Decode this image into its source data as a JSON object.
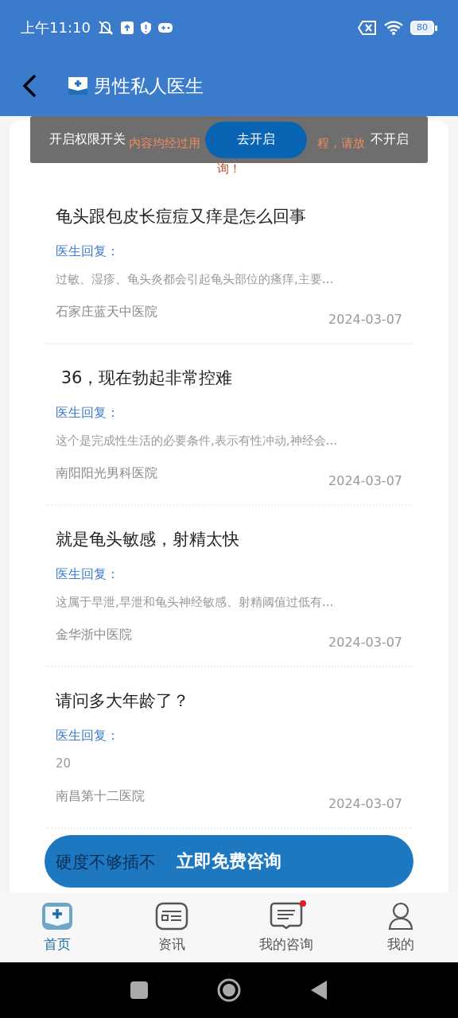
{
  "status_bar": {
    "time": "上午11:10",
    "battery": "80"
  },
  "header": {
    "title": "男性私人医生"
  },
  "notice": {
    "fragments": [
      "内容均经过用",
      "程，请放"
    ],
    "tail": "询！"
  },
  "toast": {
    "label": "开启权限开关",
    "confirm": "去开启",
    "cancel": "不开启"
  },
  "questions": [
    {
      "title": "龟头跟包皮长痘痘又痒是怎么回事",
      "reply_label": "医生回复：",
      "reply": "过敏、湿疹、龟头炎都会引起龟头部位的瘙痒,主要…",
      "hospital": "石家庄蓝天中医院",
      "date": "2024-03-07"
    },
    {
      "title": " 36，现在勃起非常控难",
      "reply_label": "医生回复：",
      "reply": "这个是完成性生活的必要条件,表示有性冲动,神经会…",
      "hospital": "南阳阳光男科医院",
      "date": "2024-03-07"
    },
    {
      "title": "就是龟头敏感，射精太快",
      "reply_label": "医生回复：",
      "reply": "这属于早泄,早泄和龟头神经敏感、射精阈值过低有…",
      "hospital": "金华浙中医院",
      "date": "2024-03-07"
    },
    {
      "title": "请问多大年龄了？",
      "reply_label": "医生回复：",
      "reply": "20",
      "hospital": "南昌第十二医院",
      "date": "2024-03-07"
    },
    {
      "title": "硬度不够插不"
    }
  ],
  "consult_button": "立即免费咨询",
  "tabs": [
    {
      "kind": "home",
      "label": "首页",
      "selected": true,
      "dot": false
    },
    {
      "kind": "news",
      "label": "资讯",
      "selected": false,
      "dot": false
    },
    {
      "kind": "chat",
      "label": "我的咨询",
      "selected": false,
      "dot": true
    },
    {
      "kind": "profile",
      "label": "我的",
      "selected": false,
      "dot": false
    }
  ]
}
